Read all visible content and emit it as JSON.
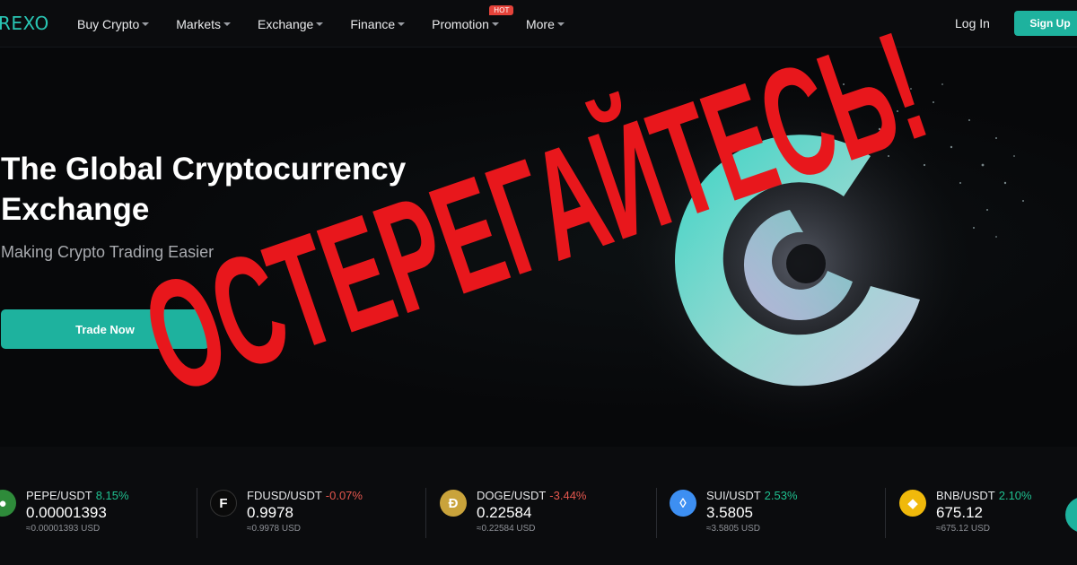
{
  "brand": {
    "logo": "REXO",
    "accent": "#1eb29e"
  },
  "nav": {
    "items": [
      {
        "label": "Buy Crypto"
      },
      {
        "label": "Markets"
      },
      {
        "label": "Exchange"
      },
      {
        "label": "Finance"
      },
      {
        "label": "Promotion",
        "badge": "HOT"
      },
      {
        "label": "More"
      }
    ],
    "login": "Log In",
    "signup": "Sign Up"
  },
  "hero": {
    "title": "The Global Cryptocurrency Exchange",
    "subtitle": "Making Crypto Trading Easier",
    "cta": "Trade Now"
  },
  "overlay": {
    "text": "ОСТЕРЕГАЙТЕСЬ!",
    "color": "#e8171c"
  },
  "ticker": [
    {
      "pair": "PEPE/USDT",
      "change": "8.15%",
      "direction": "up",
      "price": "0.00001393",
      "usd": "≈0.00001393 USD",
      "icon": "pepe-coin-icon"
    },
    {
      "pair": "FDUSD/USDT",
      "change": "-0.07%",
      "direction": "down",
      "price": "0.9978",
      "usd": "≈0.9978 USD",
      "icon": "fdusd-coin-icon"
    },
    {
      "pair": "DOGE/USDT",
      "change": "-3.44%",
      "direction": "down",
      "price": "0.22584",
      "usd": "≈0.22584 USD",
      "icon": "doge-coin-icon"
    },
    {
      "pair": "SUI/USDT",
      "change": "2.53%",
      "direction": "up",
      "price": "3.5805",
      "usd": "≈3.5805 USD",
      "icon": "sui-coin-icon"
    },
    {
      "pair": "BNB/USDT",
      "change": "2.10%",
      "direction": "up",
      "price": "675.12",
      "usd": "≈675.12 USD",
      "icon": "bnb-coin-icon"
    }
  ]
}
